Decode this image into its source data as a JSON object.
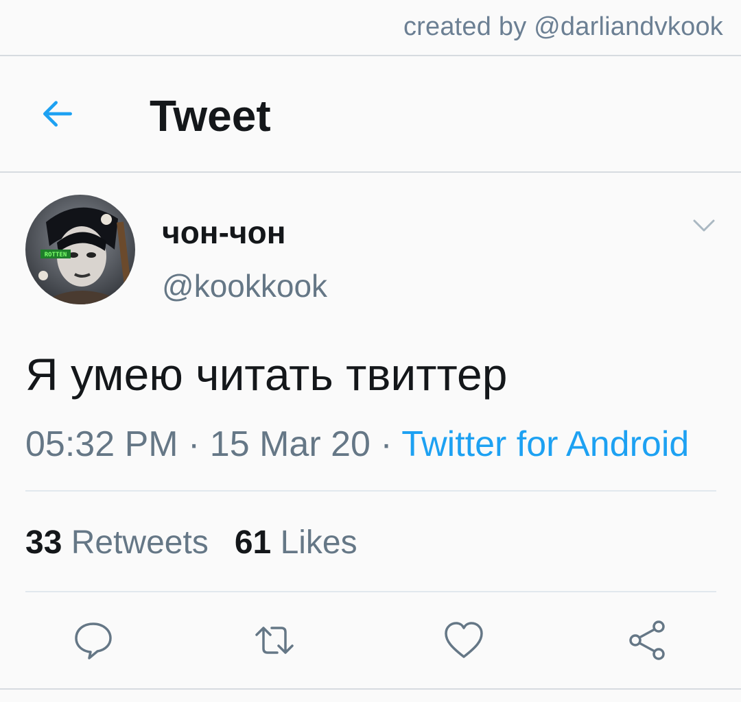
{
  "watermark": "created by @darliandvkook",
  "header": {
    "title": "Tweet",
    "back_icon": "arrow-left-icon"
  },
  "author": {
    "display_name": "чон-чон",
    "handle": "@kookkook",
    "avatar_badge": "ROTTEN"
  },
  "tweet": {
    "text": "Я умею читать твиттер",
    "time": "05:32 PM",
    "date": "15 Mar 20",
    "separator": " · ",
    "source": "Twitter for Android"
  },
  "stats": {
    "retweets_count": "33",
    "retweets_label": "Retweets",
    "likes_count": "61",
    "likes_label": "Likes"
  },
  "actions": [
    "reply-icon",
    "retweet-icon",
    "like-icon",
    "share-icon"
  ],
  "colors": {
    "accent": "#1da1f2",
    "secondary_text": "#657786",
    "primary_text": "#14171a"
  }
}
